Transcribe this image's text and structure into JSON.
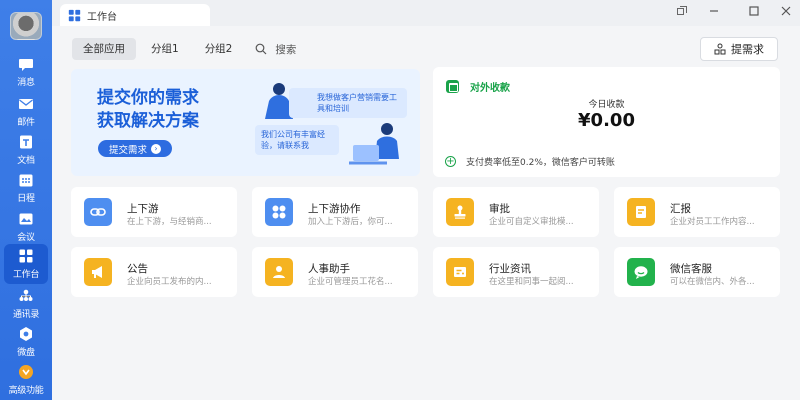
{
  "window": {
    "tab_title": "工作台"
  },
  "sidebar": {
    "items": [
      {
        "label": "消息",
        "icon": "message-icon"
      },
      {
        "label": "邮件",
        "icon": "mail-icon"
      },
      {
        "label": "文档",
        "icon": "document-icon"
      },
      {
        "label": "日程",
        "icon": "calendar-icon"
      },
      {
        "label": "会议",
        "icon": "meeting-icon"
      },
      {
        "label": "工作台",
        "icon": "workbench-icon",
        "active": true
      },
      {
        "label": "通讯录",
        "icon": "contacts-icon"
      },
      {
        "label": "微盘",
        "icon": "cloud-drive-icon"
      },
      {
        "label": "高级功能",
        "icon": "advanced-features-icon"
      }
    ]
  },
  "filters": {
    "all": "全部应用",
    "group1": "分组1",
    "group2": "分组2",
    "search": "搜索"
  },
  "toolbar": {
    "request_label": "提需求"
  },
  "banner": {
    "line1": "提交你的需求",
    "line2": "获取解决方案",
    "cta": "提交需求",
    "bubble1": "我想做客户营销需要工具和培训",
    "bubble2": "我们公司有丰富经验，请联系我"
  },
  "income": {
    "title": "对外收款",
    "subtitle": "今日收款",
    "amount": "¥0.00",
    "footer": "支付费率低至0.2%，微信客户可转账"
  },
  "apps": [
    {
      "name": "上下游",
      "desc": "在上下游，与经销商...",
      "color": "#4e8ef0",
      "icon": "link-icon"
    },
    {
      "name": "上下游协作",
      "desc": "加入上下游后，你可...",
      "color": "#4e8ef0",
      "icon": "grid-icon"
    },
    {
      "name": "审批",
      "desc": "企业可自定义审批模...",
      "color": "#f5b321",
      "icon": "stamp-icon"
    },
    {
      "name": "汇报",
      "desc": "企业对员工工作内容...",
      "color": "#f5b321",
      "icon": "report-icon"
    },
    {
      "name": "公告",
      "desc": "企业向员工发布的内...",
      "color": "#f5b321",
      "icon": "megaphone-icon"
    },
    {
      "name": "人事助手",
      "desc": "企业可管理员工花名...",
      "color": "#f5b321",
      "icon": "person-icon"
    },
    {
      "name": "行业资讯",
      "desc": "在这里和同事一起阅...",
      "color": "#f5b321",
      "icon": "news-icon"
    },
    {
      "name": "微信客服",
      "desc": "可以在微信内、外各...",
      "color": "#22b24c",
      "icon": "wechat-service-icon"
    }
  ]
}
